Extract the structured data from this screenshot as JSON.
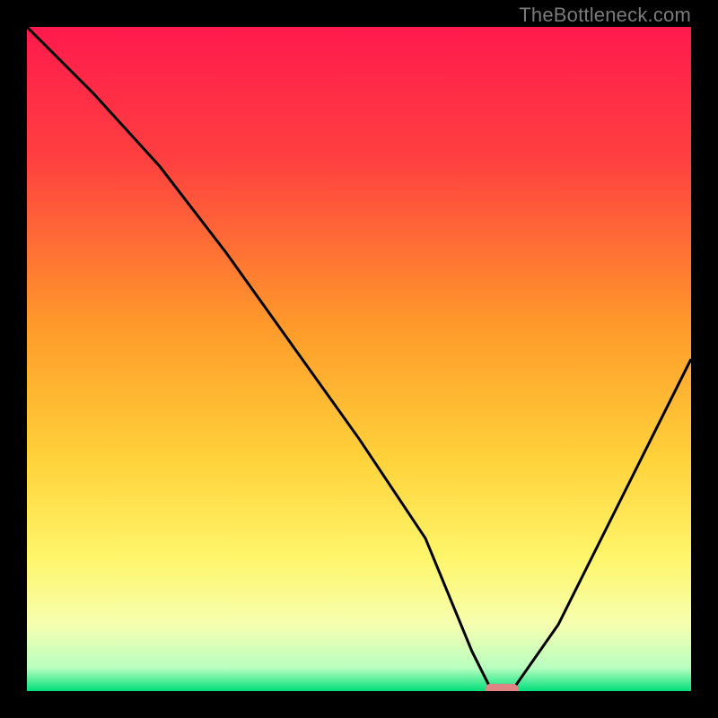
{
  "watermark": "TheBottleneck.com",
  "chart_data": {
    "type": "line",
    "title": "",
    "xlabel": "",
    "ylabel": "",
    "xlim": [
      0,
      100
    ],
    "ylim": [
      0,
      100
    ],
    "grid": false,
    "series": [
      {
        "name": "bottleneck-curve",
        "color": "#000000",
        "x": [
          0,
          10,
          20,
          30,
          40,
          50,
          60,
          67,
          70,
          73,
          80,
          90,
          100
        ],
        "y": [
          100,
          90,
          79,
          66,
          52,
          38,
          23,
          6,
          0,
          0,
          10,
          30,
          50
        ]
      }
    ],
    "marker": {
      "name": "optimal-marker",
      "color": "#e08585",
      "x": 71.5,
      "y": 0,
      "width": 5,
      "height": 2.2
    },
    "gradient_stops": [
      {
        "offset": 0.0,
        "color": "#ff1a4d"
      },
      {
        "offset": 0.2,
        "color": "#ff4040"
      },
      {
        "offset": 0.45,
        "color": "#ff9a2a"
      },
      {
        "offset": 0.65,
        "color": "#ffd23a"
      },
      {
        "offset": 0.8,
        "color": "#fff66b"
      },
      {
        "offset": 0.9,
        "color": "#f6ffb0"
      },
      {
        "offset": 0.965,
        "color": "#b8ffc0"
      },
      {
        "offset": 1.0,
        "color": "#00df7a"
      }
    ]
  }
}
